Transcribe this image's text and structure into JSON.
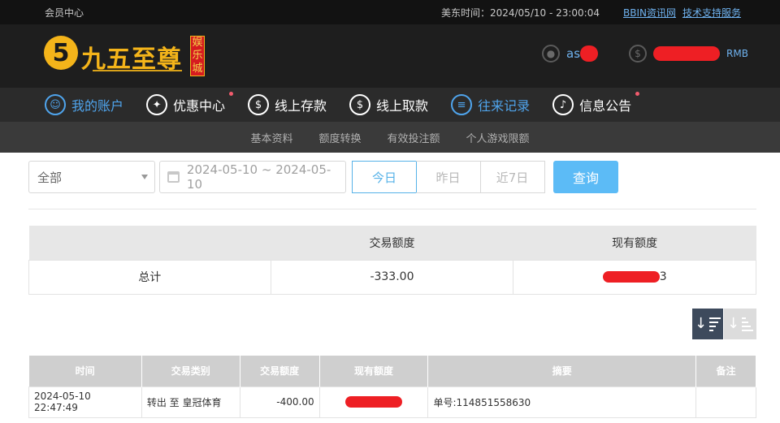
{
  "topbar": {
    "left_label": "会员中心",
    "time_label": "美东时间：2024/05/10 - 23:00:04",
    "link_news": "BBIN资讯网",
    "link_support": "技术支持服务"
  },
  "header": {
    "logo_digit": "5",
    "logo_text": "九五至尊",
    "logo_tag": "娱乐城",
    "username_prefix": "as",
    "balance_suffix": "RMB",
    "user_icon": "user-icon",
    "dollar_icon": "dollar-icon"
  },
  "mainnav": [
    {
      "label": "我的账户",
      "icon": "person-icon",
      "glyph": "☺",
      "active": true,
      "dot": false
    },
    {
      "label": "优惠中心",
      "icon": "gift-icon",
      "glyph": "✦",
      "active": false,
      "dot": true
    },
    {
      "label": "线上存款",
      "icon": "deposit-icon",
      "glyph": "$",
      "active": false,
      "dot": false
    },
    {
      "label": "线上取款",
      "icon": "withdraw-icon",
      "glyph": "$",
      "active": false,
      "dot": false
    },
    {
      "label": "往来记录",
      "icon": "record-icon",
      "glyph": "≡",
      "active": true,
      "dot": false
    },
    {
      "label": "信息公告",
      "icon": "bell-icon",
      "glyph": "♪",
      "active": false,
      "dot": true
    }
  ],
  "subnav": [
    "基本资料",
    "额度转换",
    "有效投注额",
    "个人游戏限额"
  ],
  "filters": {
    "select_value": "全部",
    "date_range": "2024-05-10 ~ 2024-05-10",
    "seg_today": "今日",
    "seg_yesterday": "昨日",
    "seg_7days": "近7日",
    "query_button": "查询"
  },
  "summary": {
    "col_trade": "交易额度",
    "col_current": "现有额度",
    "row_label": "总计",
    "row_trade": "-333.00",
    "row_current_tail": "3"
  },
  "detail": {
    "headers": [
      "时间",
      "交易类别",
      "交易额度",
      "现有额度",
      "摘要",
      "备注"
    ],
    "rows": [
      {
        "time": "2024-05-10 22:47:49",
        "type": "转出 至 皇冠体育",
        "amount": "-400.00",
        "current": "",
        "summary": "单号:114851558630",
        "note": ""
      }
    ]
  },
  "colors": {
    "accent_blue": "#4fa4ec",
    "query_button": "#5cbbf6",
    "redaction": "#ee1f24",
    "logo_gold": "#f4b41a"
  }
}
